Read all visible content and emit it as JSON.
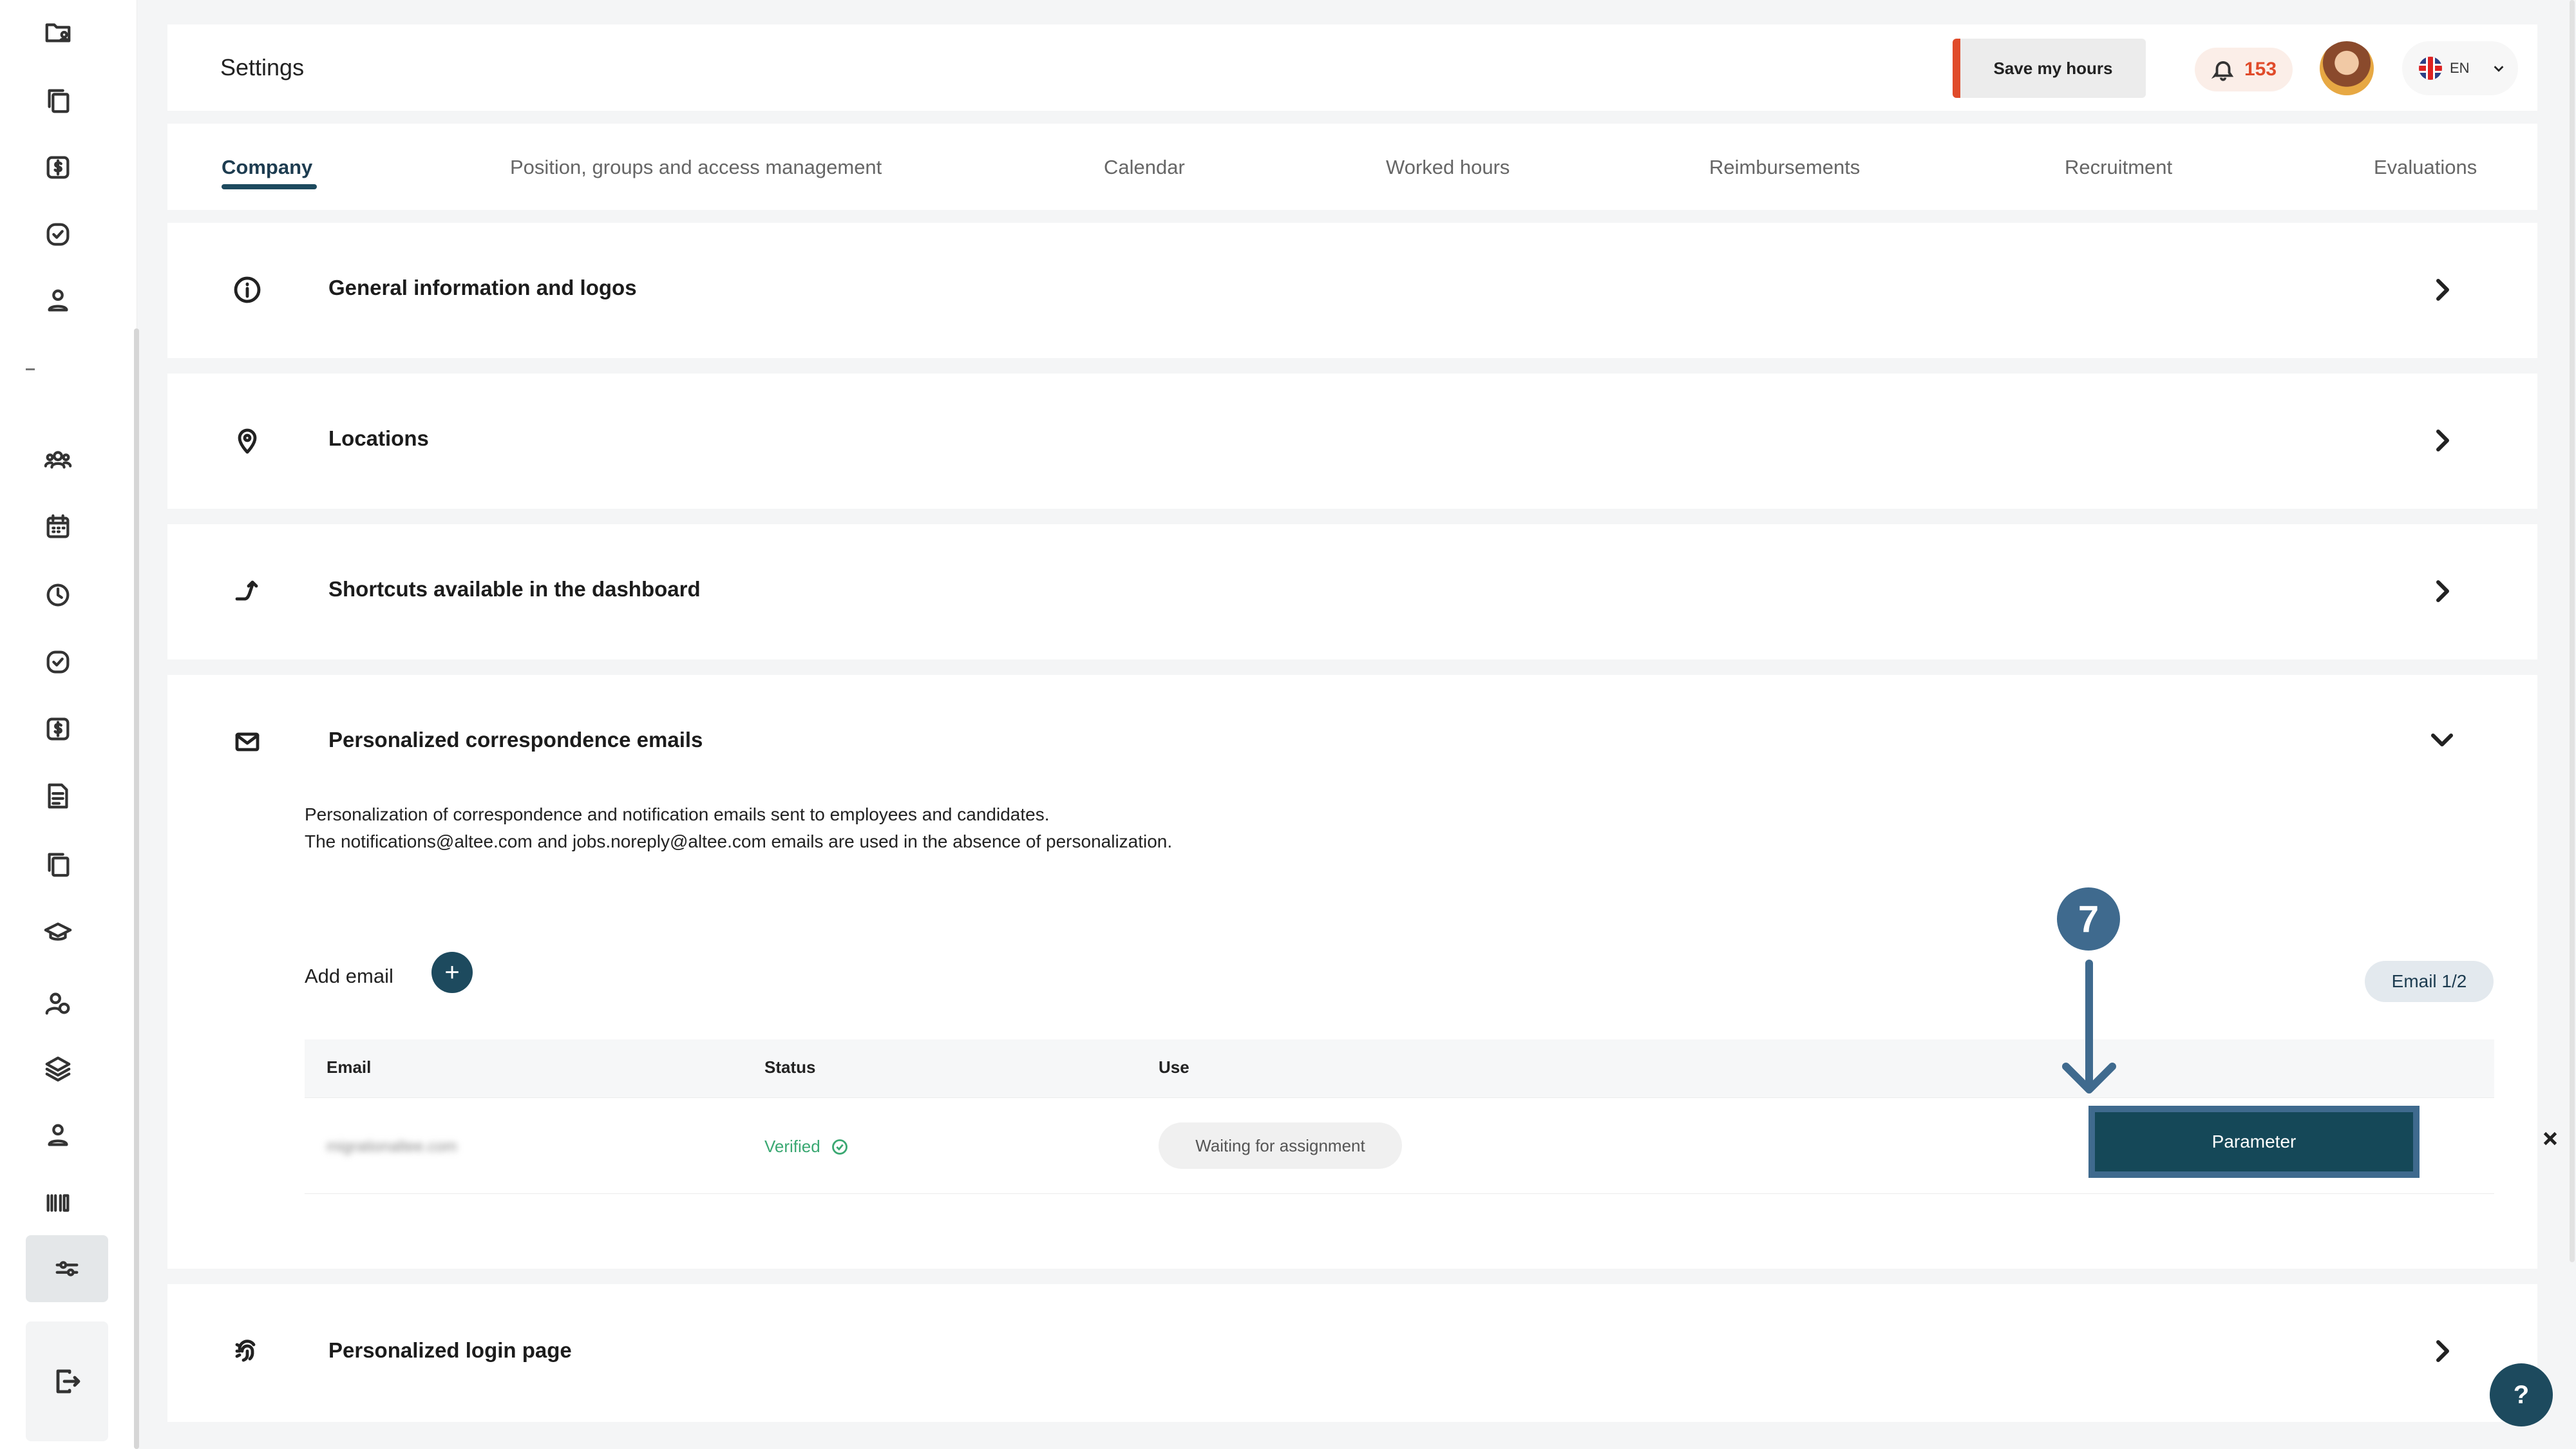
{
  "header": {
    "title": "Settings",
    "save_label": "Save my hours",
    "notification_count": "153",
    "language": "EN"
  },
  "tabs": [
    {
      "label": "Company",
      "active": true
    },
    {
      "label": "Position, groups and access management"
    },
    {
      "label": "Calendar"
    },
    {
      "label": "Worked hours"
    },
    {
      "label": "Reimbursements"
    },
    {
      "label": "Recruitment"
    },
    {
      "label": "Evaluations"
    }
  ],
  "sections": [
    {
      "title": "General information and logos",
      "icon": "info-icon",
      "expanded": false
    },
    {
      "title": "Locations",
      "icon": "location-pin-icon",
      "expanded": false
    },
    {
      "title": "Shortcuts available in the dashboard",
      "icon": "shortcut-arrow-icon",
      "expanded": false
    },
    {
      "title": "Personalized correspondence emails",
      "icon": "mail-icon",
      "expanded": true
    },
    {
      "title": "Personalized login page",
      "icon": "fingerprint-icon",
      "expanded": false
    }
  ],
  "emails": {
    "description_line1": "Personalization of correspondence and notification emails sent to employees and candidates.",
    "description_line2": "The notifications@altee.com and jobs.noreply@altee.com emails are used in the absence of personalization.",
    "add_label": "Add email",
    "count_label": "Email 1/2",
    "columns": {
      "email": "Email",
      "status": "Status",
      "use": "Use"
    },
    "rows": [
      {
        "email": "migrationaltee.com",
        "status": "Verified",
        "use": "Waiting for assignment",
        "action": "Parameter"
      }
    ]
  },
  "annotation": {
    "step": "7"
  },
  "help_label": "?",
  "colors": {
    "brand": "#1d4a5e",
    "accent": "#e04b2a",
    "success": "#3aa872",
    "annotation": "#3f6a8e"
  }
}
